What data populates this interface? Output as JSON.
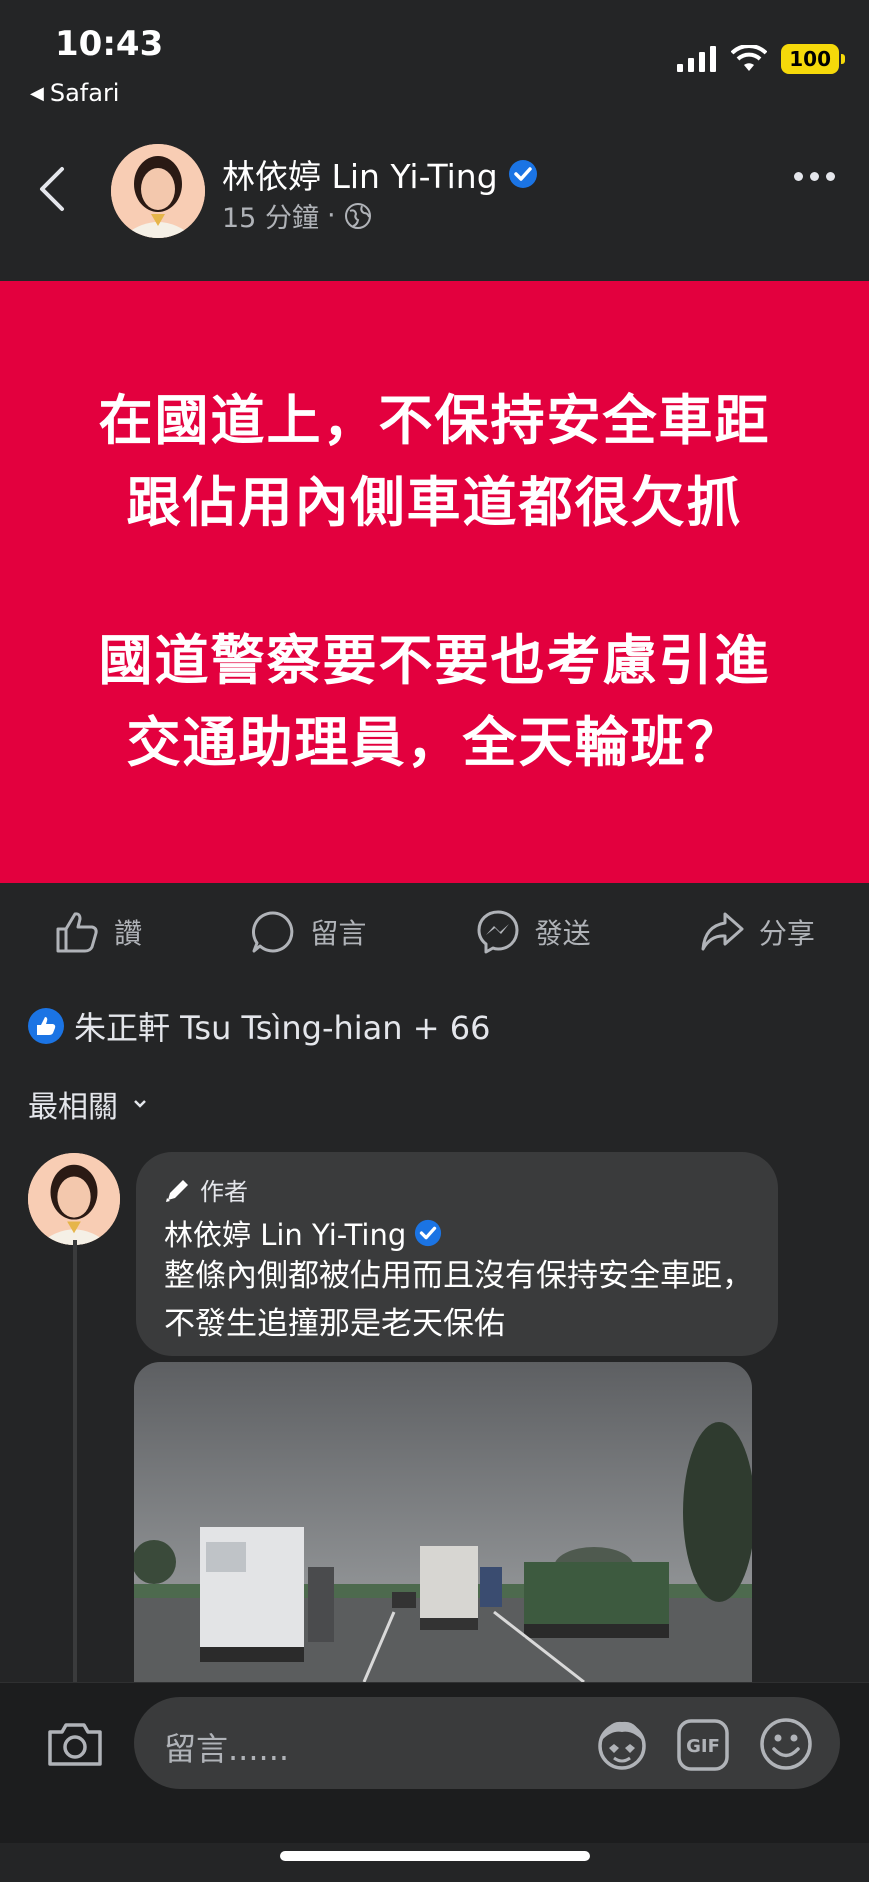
{
  "status_bar": {
    "time": "10:43",
    "back_app": "Safari",
    "battery": "100"
  },
  "post": {
    "author": "林依婷 Lin Yi-Ting",
    "time_ago": "15 分鐘",
    "separator": "·",
    "banner_lines": [
      "在國道上，不保持安全車距",
      "跟佔用內側車道都很欠抓",
      "國道警察要不要也考慮引進",
      "交通助理員，全天輪班？"
    ],
    "banner_color": "#e3003e"
  },
  "actions": {
    "like": "讚",
    "comment": "留言",
    "send": "發送",
    "share": "分享"
  },
  "reactions": {
    "text": "朱正軒 Tsu Tsìng-hian + 66"
  },
  "sort": {
    "label": "最相關"
  },
  "comment": {
    "author_tag": "作者",
    "author": "林依婷 Lin Yi-Ting",
    "text": "整條內側都被佔用而且沒有保持安全車距，不發生追撞那是老天保佑"
  },
  "composer": {
    "placeholder": "留言......"
  },
  "icons": [
    "back-chevron-icon",
    "globe-icon",
    "verified-badge-icon",
    "more-icon",
    "like-icon",
    "comment-icon",
    "messenger-icon",
    "share-icon",
    "camera-icon",
    "avatar-sticker-icon",
    "gif-icon",
    "emoji-icon"
  ],
  "colors": {
    "background": "#242526",
    "accent": "#1b74e4"
  }
}
